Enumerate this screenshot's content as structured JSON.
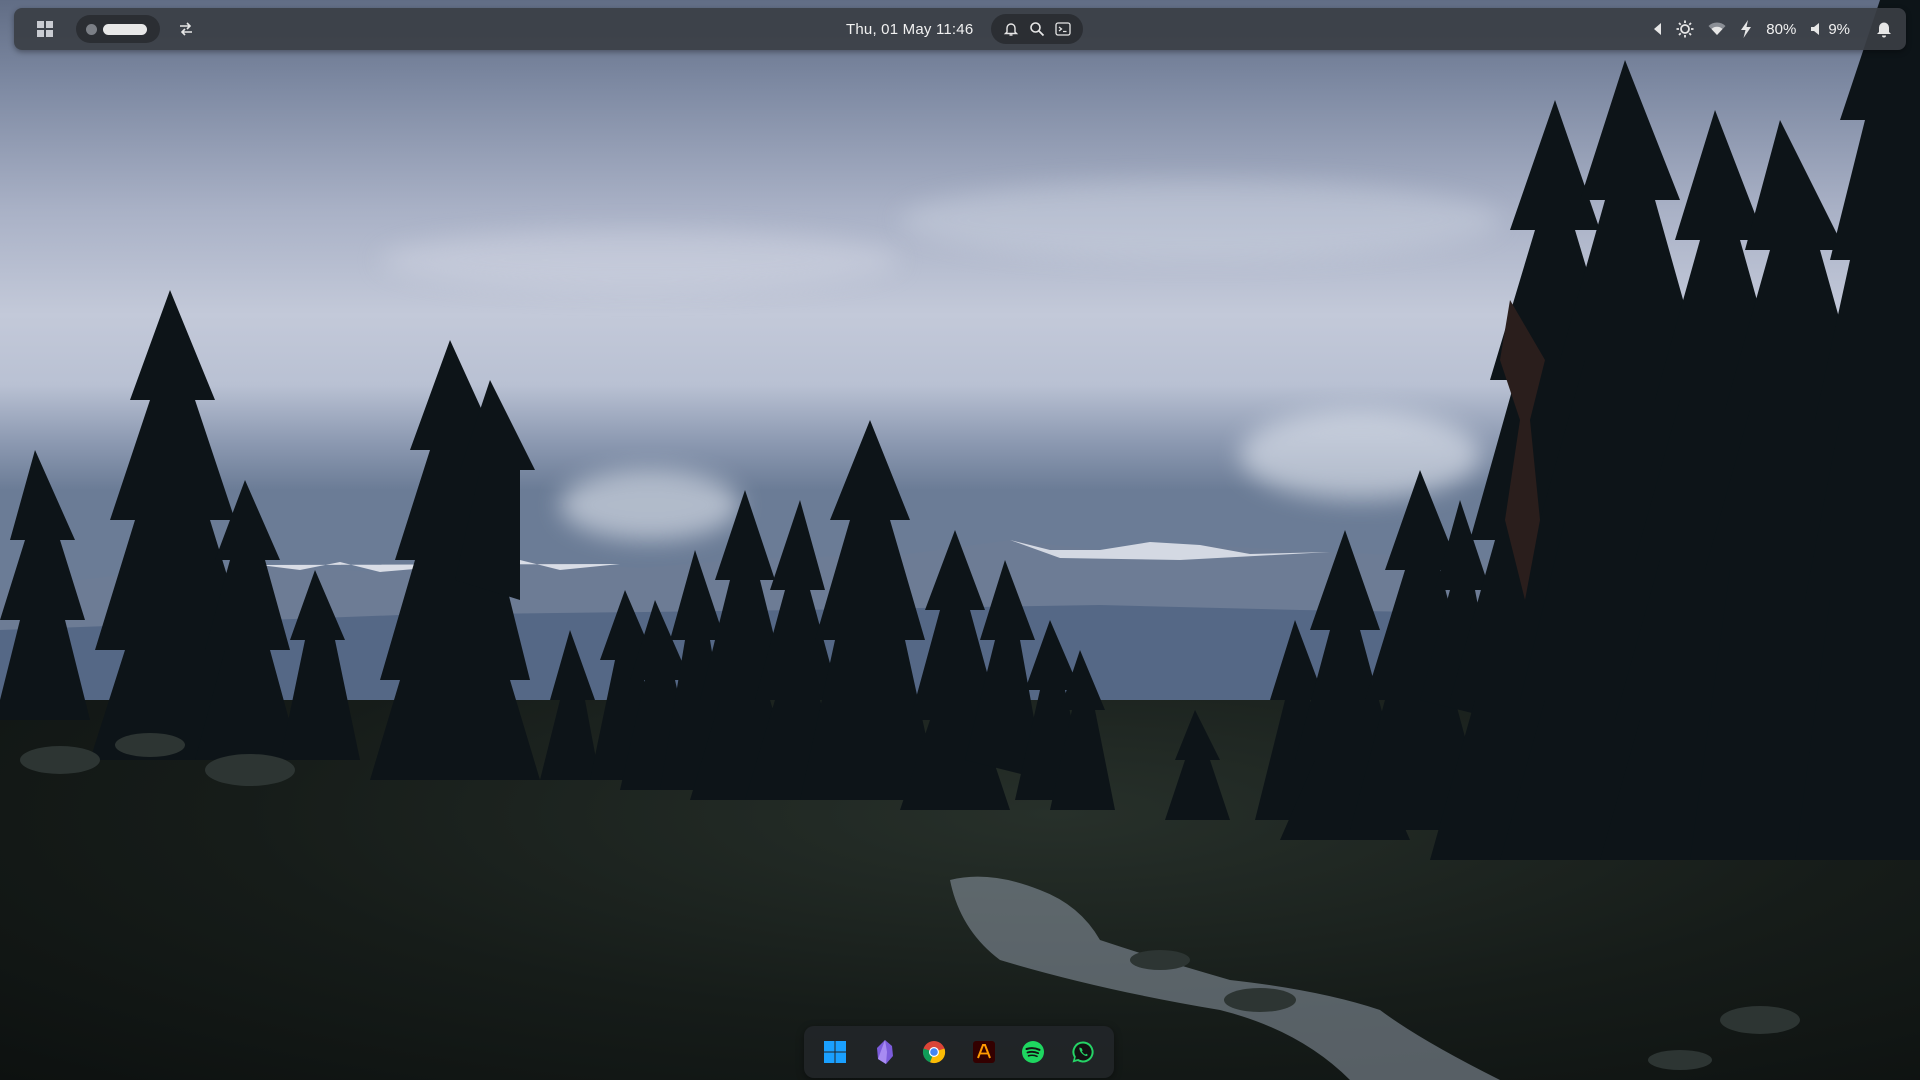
{
  "top_panel": {
    "clock": "Thu, 01 May 11:46",
    "center_icons": [
      "bell-icon",
      "search-icon",
      "terminal-icon"
    ],
    "tray": {
      "battery": "80%",
      "volume": "9%"
    }
  },
  "dock": {
    "items": [
      "windows-start",
      "obsidian",
      "google-chrome",
      "adobe-illustrator",
      "spotify",
      "whatsapp"
    ]
  },
  "colors": {
    "panel_bg": "#3a3e44",
    "spotify_green": "#1ed760",
    "whatsapp_green": "#25d366",
    "windows_blue": "#1aa0ff",
    "illustrator_orange": "#ff9a00"
  }
}
